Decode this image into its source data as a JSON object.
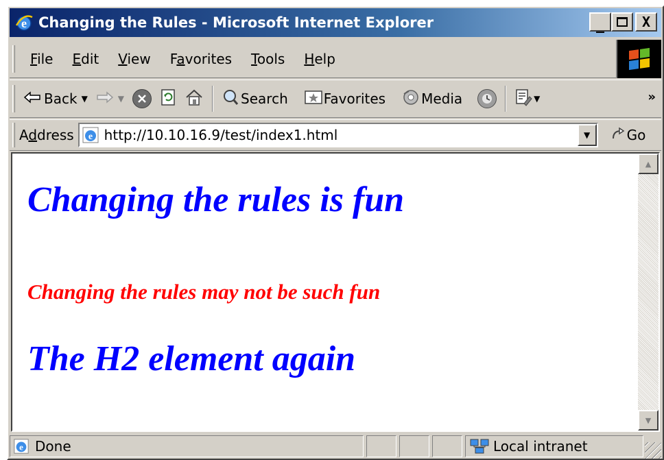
{
  "window": {
    "title": "Changing the Rules - Microsoft Internet Explorer",
    "buttons": {
      "minimize": "_",
      "maximize": "□",
      "close": "X"
    }
  },
  "menu": {
    "items": [
      {
        "label": "File",
        "accel": "F",
        "rest": "ile"
      },
      {
        "label": "Edit",
        "accel": "E",
        "rest": "dit"
      },
      {
        "label": "View",
        "accel": "V",
        "rest": "iew"
      },
      {
        "label": "Favorites",
        "pre": "F",
        "accel": "a",
        "rest": "vorites"
      },
      {
        "label": "Tools",
        "accel": "T",
        "rest": "ools"
      },
      {
        "label": "Help",
        "accel": "H",
        "rest": "elp"
      }
    ]
  },
  "toolbar": {
    "back_label": "Back",
    "search_label": "Search",
    "favorites_label": "Favorites",
    "media_label": "Media",
    "more": "»"
  },
  "address": {
    "label_pre": "A",
    "label_accel": "d",
    "label_rest": "dress",
    "url": "http://10.10.16.9/test/index1.html",
    "go_label": "Go"
  },
  "page": {
    "heading1": "Changing the rules is fun",
    "heading2": "Changing the rules may not be such fun",
    "heading3": "The H2 element again"
  },
  "status": {
    "text": "Done",
    "zone": "Local intranet"
  },
  "colors": {
    "heading_blue": "#0000ff",
    "heading_red": "#ff0000",
    "titlebar_start": "#0a246a",
    "titlebar_end": "#a6caf0",
    "chrome": "#d4d0c8"
  }
}
